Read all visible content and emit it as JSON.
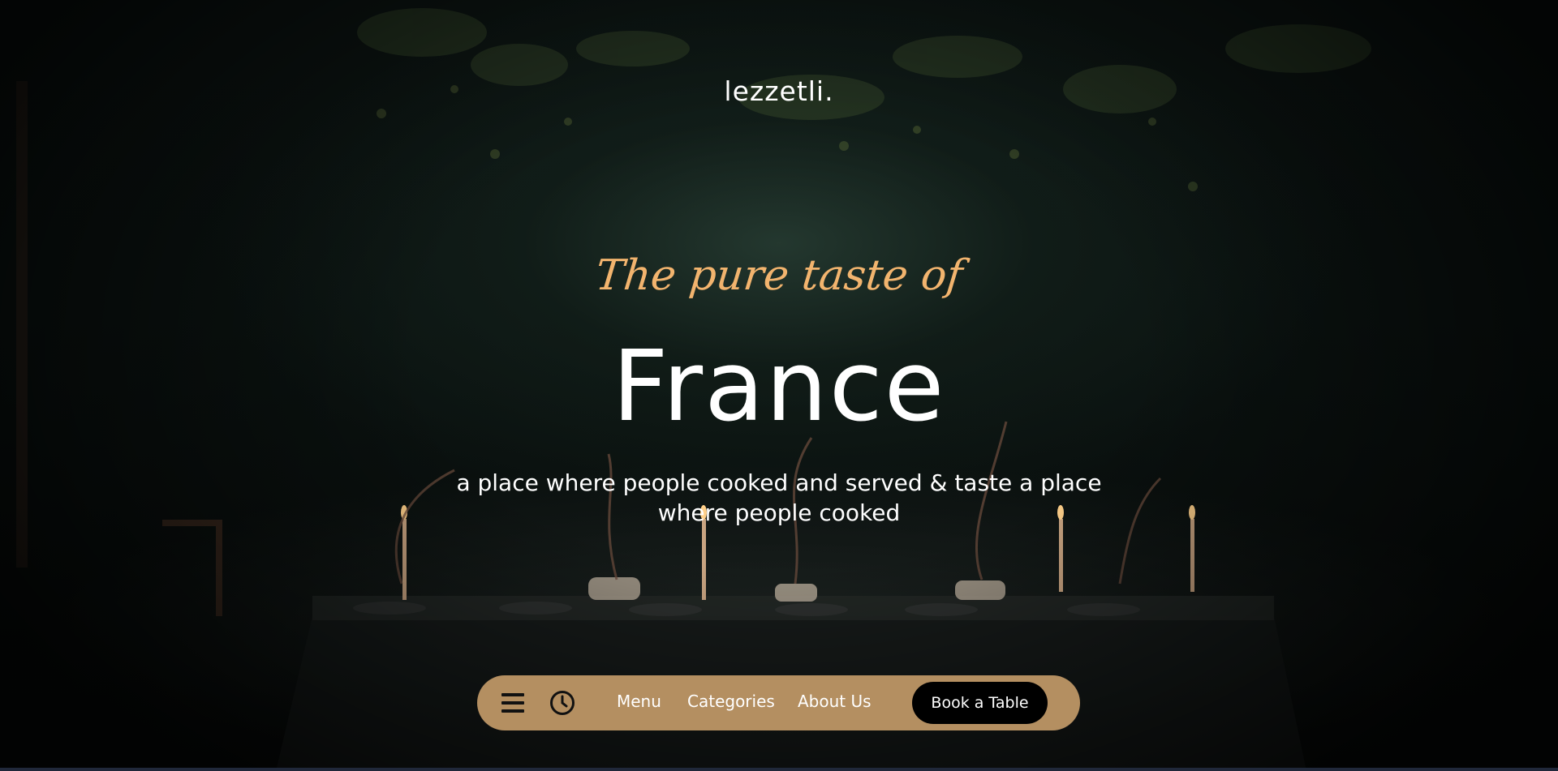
{
  "brand": {
    "name": "lezzetli."
  },
  "hero": {
    "tagline": "The pure taste of",
    "headline": "France",
    "subtitle": "a place where people cooked and served & taste a place where people cooked"
  },
  "navbar": {
    "icons": [
      "menu-icon",
      "clock-icon"
    ],
    "links": [
      {
        "label": "Menu"
      },
      {
        "label": "Categories"
      },
      {
        "label": "About Us"
      }
    ],
    "cta_label": "Book a Table"
  },
  "colors": {
    "accent_gold": "#f2b46e",
    "navbar_tan": "#b48f61",
    "cta_black": "#000000",
    "text_white": "#ffffff"
  }
}
